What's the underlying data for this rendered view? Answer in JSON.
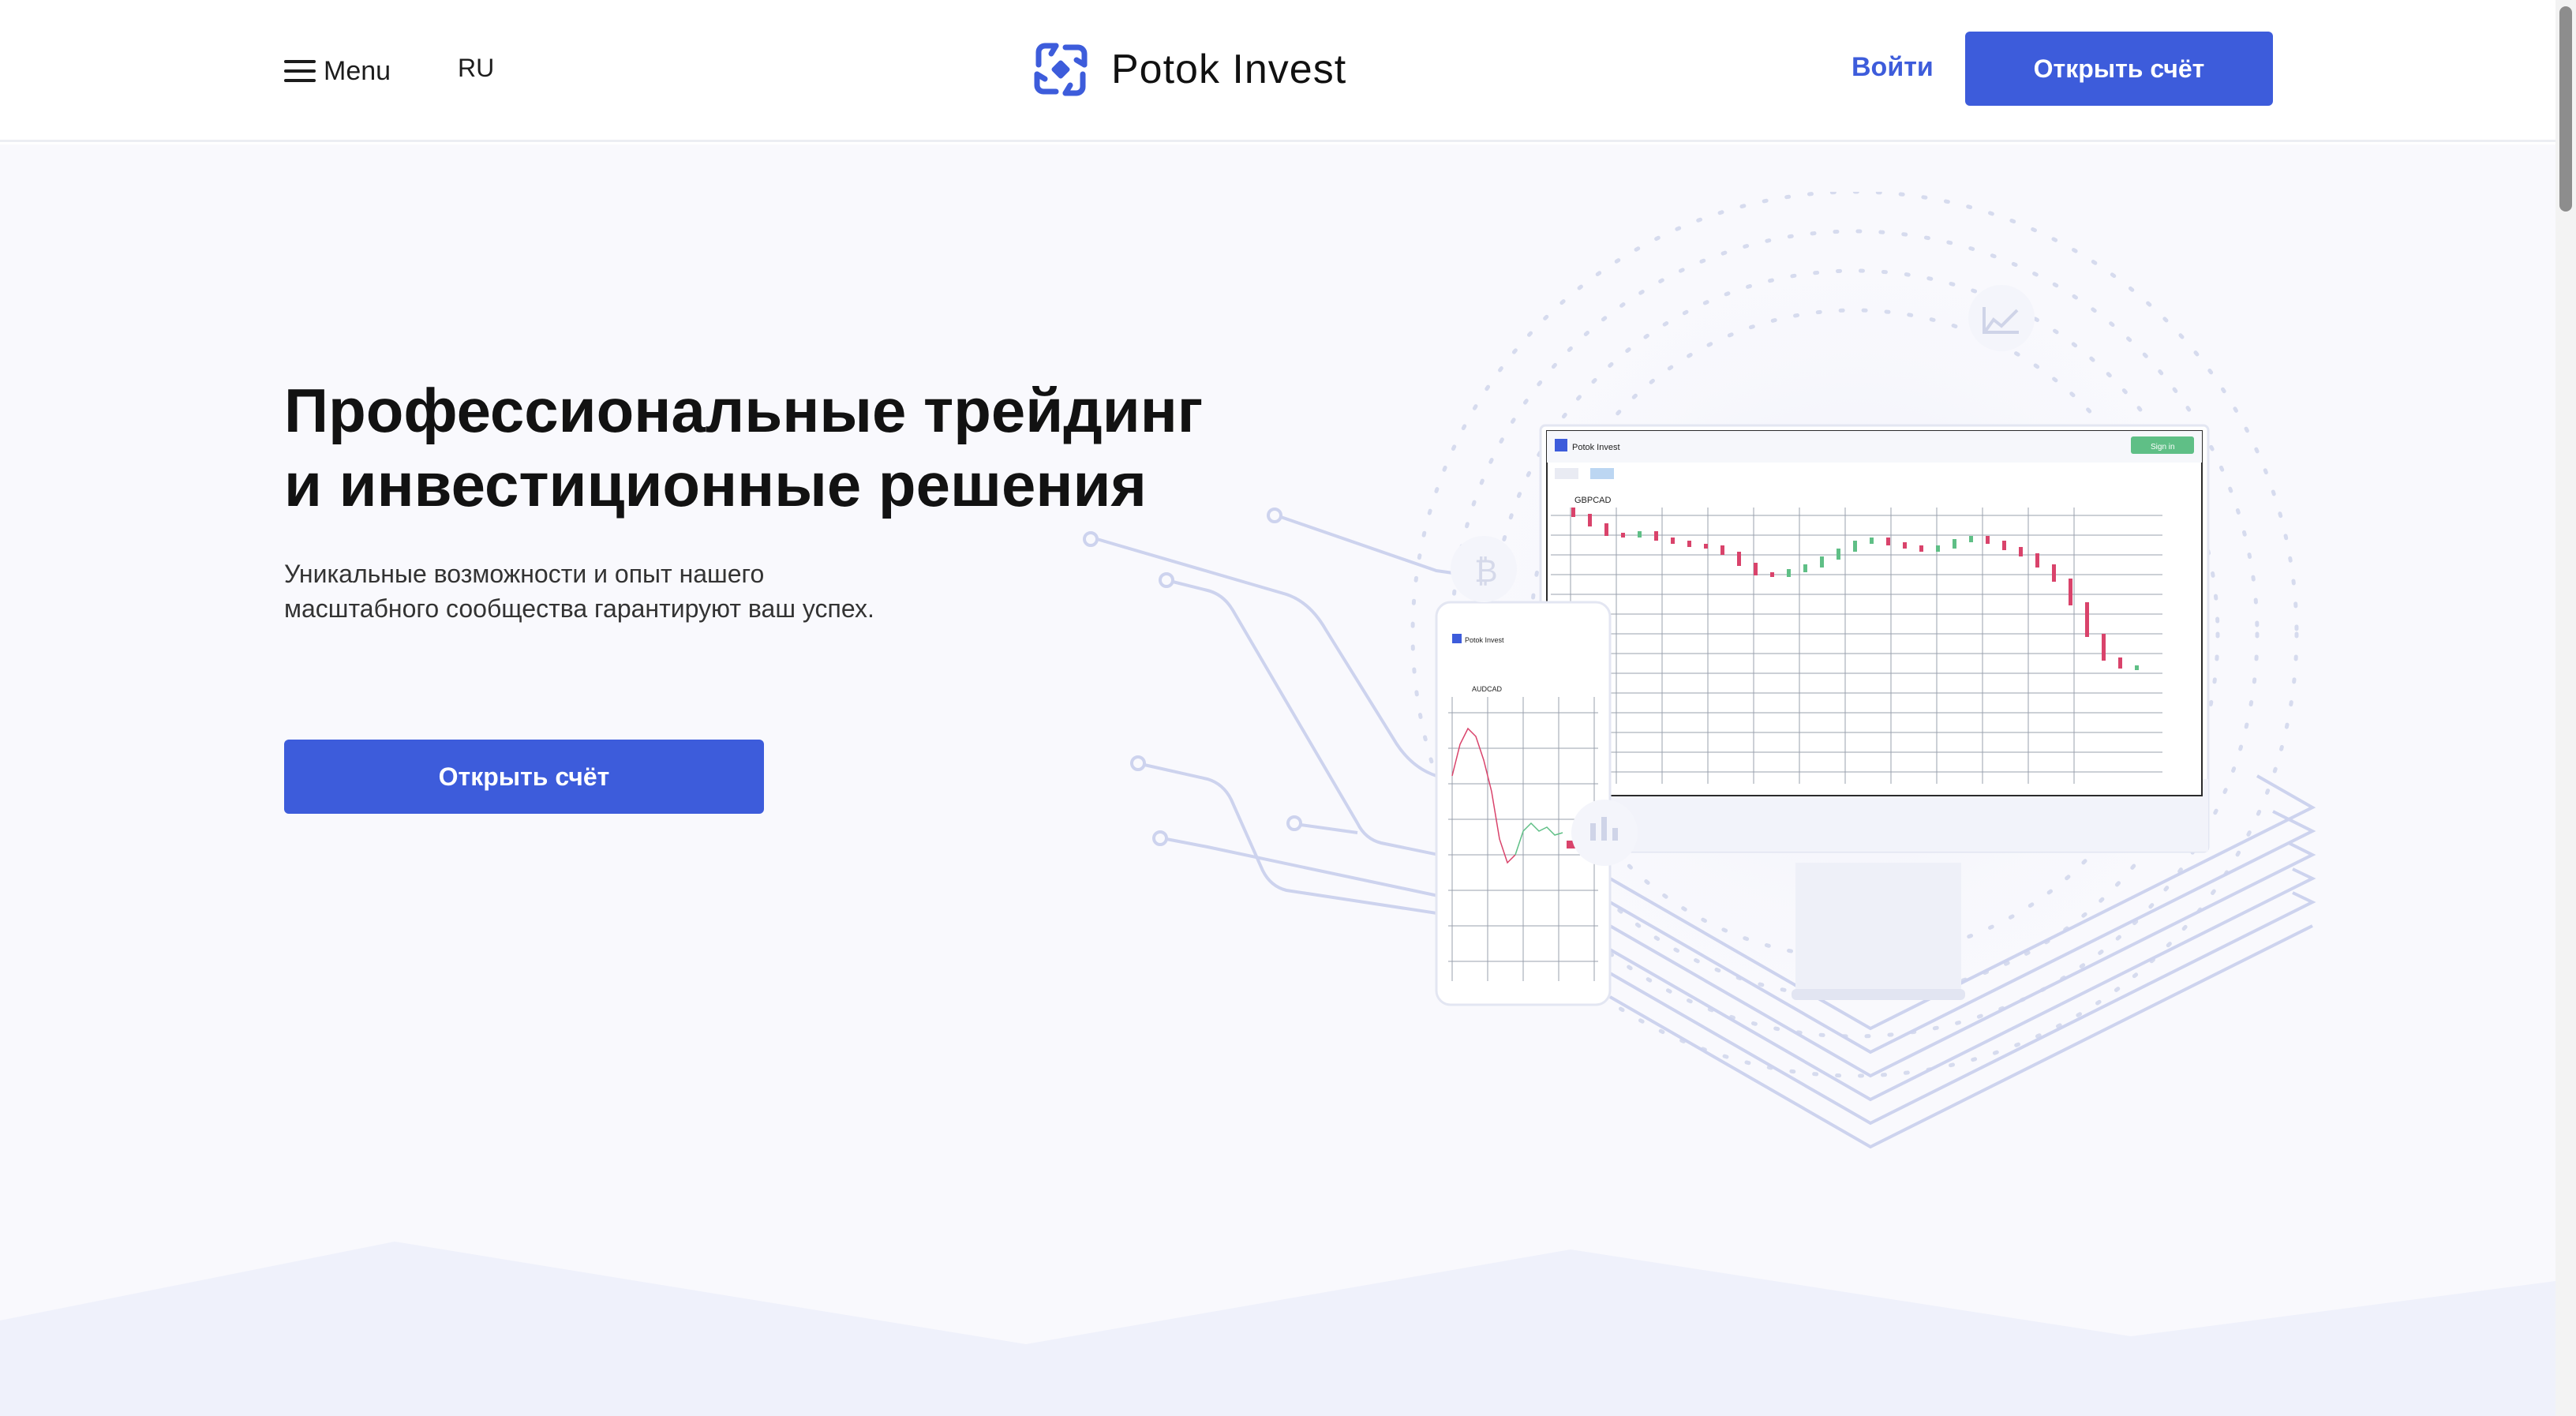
{
  "header": {
    "menu_label": "Menu",
    "language": "RU",
    "logo_text": "Potok Invest",
    "login_label": "Войти",
    "open_account_label": "Открыть счёт"
  },
  "hero": {
    "title_line1": "Профессиональные трейдинг",
    "title_line2": "и инвестиционные решения",
    "subtitle_line1": "Уникальные возможности и опыт нашего",
    "subtitle_line2": "масштабного сообщества гарантируют ваш успех.",
    "cta_label": "Открыть счёт"
  },
  "illustration": {
    "desktop_app_name": "Potok Invest",
    "desktop_symbol": "GBPCAD",
    "desktop_signin_label": "Sign in",
    "mobile_app_name": "Potok Invest",
    "mobile_symbol": "AUDCAD",
    "icons": [
      "bitcoin-icon",
      "line-chart-icon",
      "bar-chart-icon"
    ]
  },
  "colors": {
    "brand": "#3d5cdb",
    "candle_up": "#5fbf86",
    "candle_down": "#d9436b",
    "hero_bg": "#f9f9fd"
  }
}
